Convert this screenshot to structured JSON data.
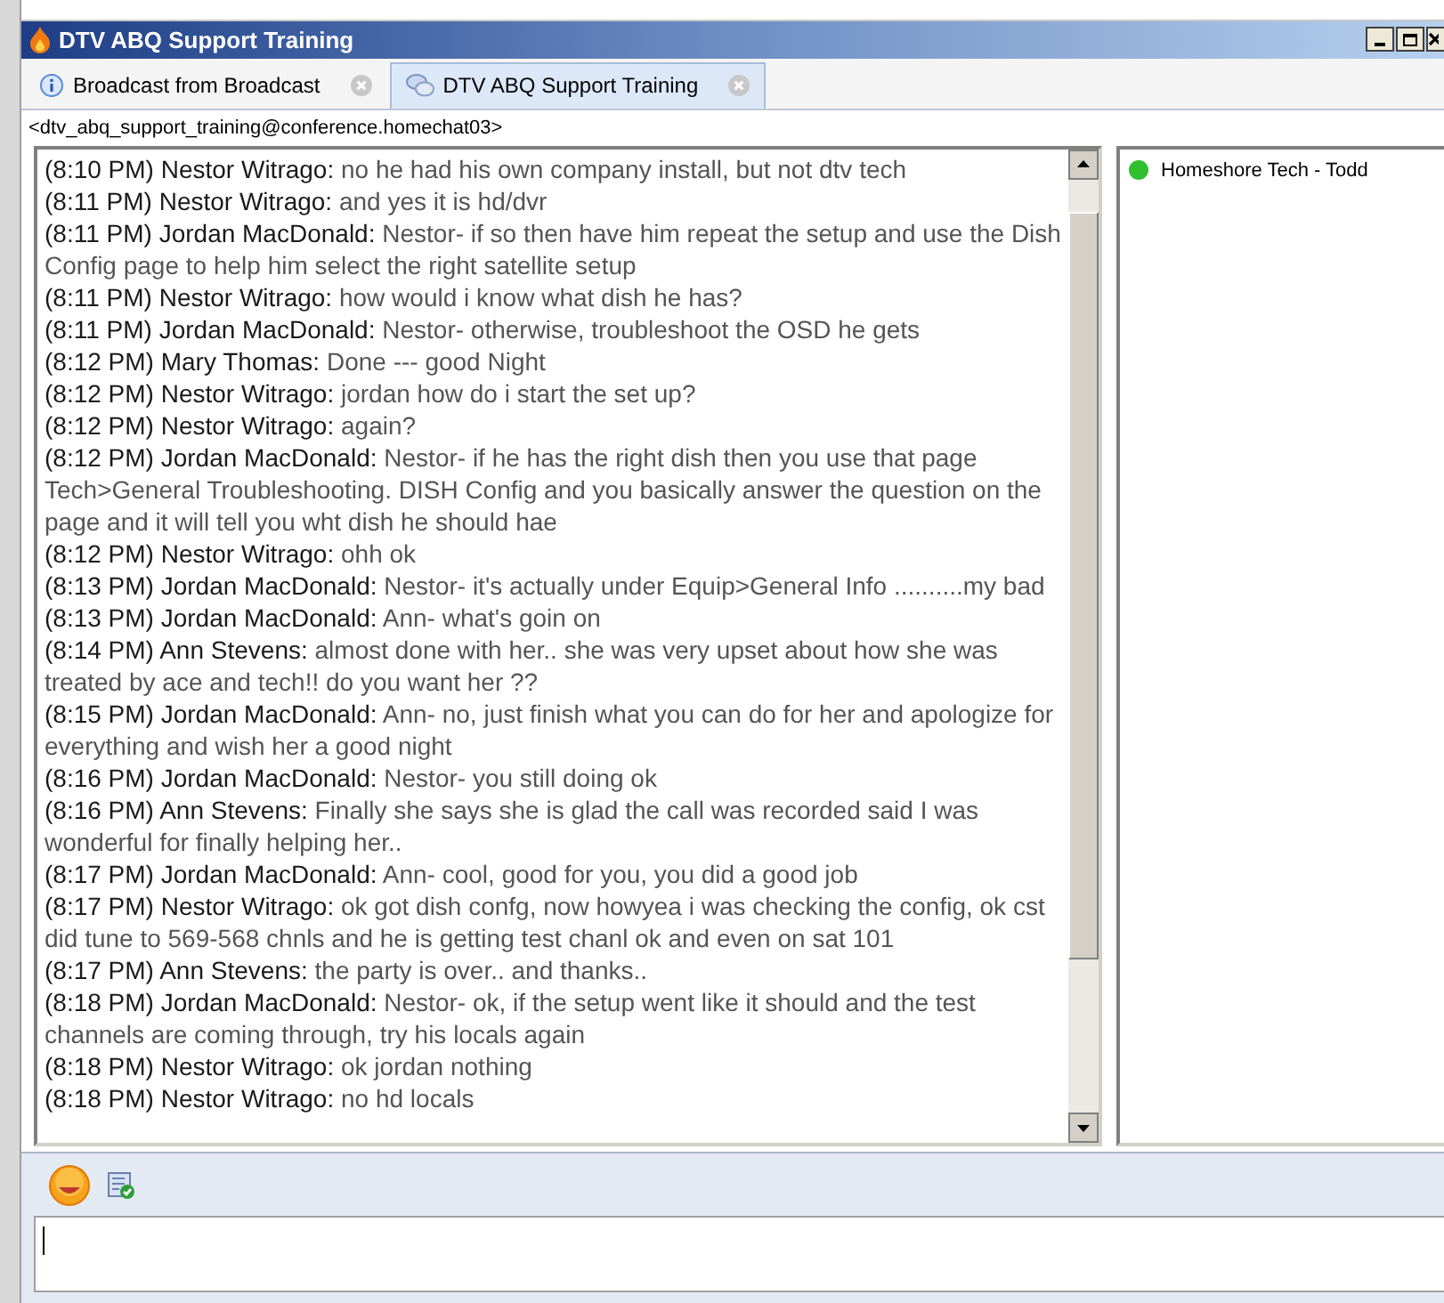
{
  "window": {
    "title": "DTV ABQ Support Training"
  },
  "tabs": [
    {
      "label": "Broadcast from Broadcast",
      "kind": "info",
      "selected": false
    },
    {
      "label": "DTV ABQ Support Training",
      "kind": "chat",
      "selected": true
    }
  ],
  "room_address": "<dtv_abq_support_training@conference.homechat03>",
  "messages": [
    {
      "time": "(8:10 PM)",
      "sender": "Nestor Witrago:",
      "text": "no he had his own company install, but not dtv tech"
    },
    {
      "time": "(8:11 PM)",
      "sender": "Nestor Witrago:",
      "text": "and yes it is hd/dvr"
    },
    {
      "time": "(8:11 PM)",
      "sender": "Jordan MacDonald:",
      "text": "Nestor- if so then have him repeat the setup and use the Dish Config page to help him select the right satellite setup"
    },
    {
      "time": "(8:11 PM)",
      "sender": "Nestor Witrago:",
      "text": "how would i know what dish he has?"
    },
    {
      "time": "(8:11 PM)",
      "sender": "Jordan MacDonald:",
      "text": "Nestor- otherwise, troubleshoot the OSD he gets"
    },
    {
      "time": "(8:12 PM)",
      "sender": "Mary Thomas:",
      "text": "Done --- good Night"
    },
    {
      "time": "(8:12 PM)",
      "sender": "Nestor Witrago:",
      "text": "jordan how do i start the set up?"
    },
    {
      "time": "(8:12 PM)",
      "sender": "Nestor Witrago:",
      "text": "again?"
    },
    {
      "time": "(8:12 PM)",
      "sender": "Jordan MacDonald:",
      "text": "Nestor- if he has the right dish then you use that page Tech>General Troubleshooting. DISH Config and you basically answer the question on the page and it will tell you wht dish he should hae"
    },
    {
      "time": "(8:12 PM)",
      "sender": "Nestor Witrago:",
      "text": "ohh ok"
    },
    {
      "time": "(8:13 PM)",
      "sender": "Jordan MacDonald:",
      "text": "Nestor- it's actually under Equip>General Info ..........my bad"
    },
    {
      "time": "(8:13 PM)",
      "sender": "Jordan MacDonald:",
      "text": "Ann- what's goin on"
    },
    {
      "time": "(8:14 PM)",
      "sender": "Ann Stevens:",
      "text": "almost done with her.. she was very upset about how she was treated by ace and tech!!  do you want her ??"
    },
    {
      "time": "(8:15 PM)",
      "sender": "Jordan MacDonald:",
      "text": "Ann- no, just finish what you can do for her and apologize for everything and wish her a good night"
    },
    {
      "time": "(8:16 PM)",
      "sender": "Jordan MacDonald:",
      "text": "Nestor- you still doing ok"
    },
    {
      "time": "(8:16 PM)",
      "sender": "Ann Stevens:",
      "text": "Finally she says she is glad the call was recorded said I was wonderful for finally helping her.."
    },
    {
      "time": "(8:17 PM)",
      "sender": "Jordan MacDonald:",
      "text": "Ann- cool, good for you, you did  a good job"
    },
    {
      "time": "(8:17 PM)",
      "sender": "Nestor Witrago:",
      "text": "ok got dish confg, now howyea i was checking the config, ok cst did tune to 569-568 chnls and he is getting test chanl ok and even on sat 101"
    },
    {
      "time": "(8:17 PM)",
      "sender": "Ann Stevens:",
      "text": "the party is over..  and thanks.."
    },
    {
      "time": "(8:18 PM)",
      "sender": "Jordan MacDonald:",
      "text": "Nestor- ok, if the setup went like it should and the test channels are coming through, try his locals again"
    },
    {
      "time": "(8:18 PM)",
      "sender": "Nestor Witrago:",
      "text": "ok jordan nothing"
    },
    {
      "time": "(8:18 PM)",
      "sender": "Nestor Witrago:",
      "text": "no  hd locals"
    }
  ],
  "participants": [
    {
      "name": "Homeshore Tech - Todd",
      "color": "#2fbf2f"
    }
  ]
}
